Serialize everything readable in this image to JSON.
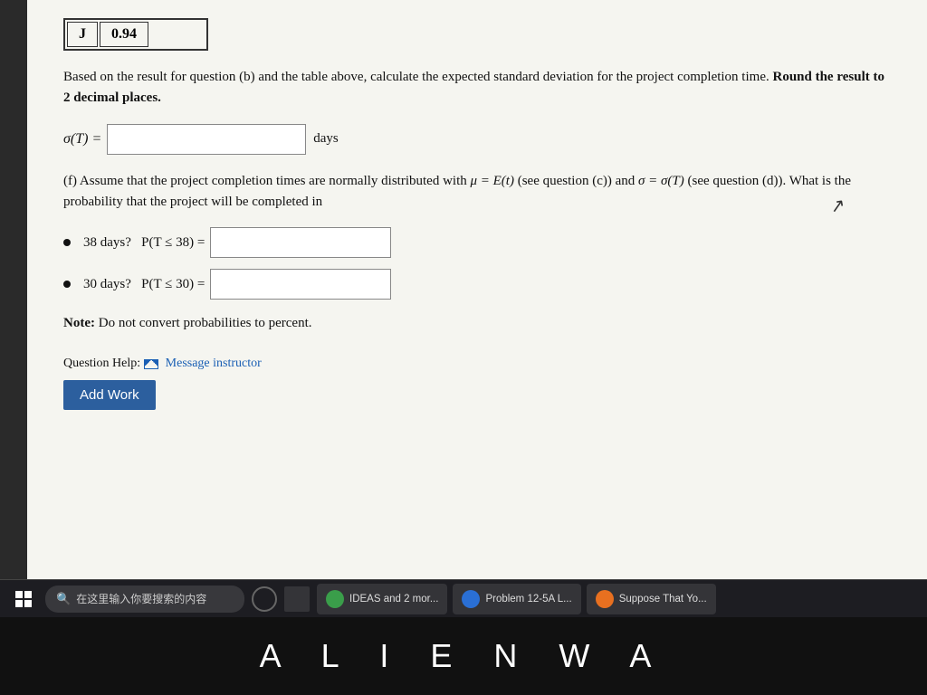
{
  "table": {
    "col1": "J",
    "col2": "0.94"
  },
  "question_c": {
    "text": "Based on the result for question (b) and the table above, calculate the expected standard deviation for the project completion time.",
    "bold_part": "Round the result to 2 decimal places.",
    "sigma_label": "σ(T) =",
    "days_label": "days",
    "input_placeholder": ""
  },
  "question_f": {
    "intro": "Assume that the project completion times are normally distributed with",
    "mu_part": "μ = E(t)",
    "see_c": "(see question (c)) and",
    "sigma_part": "σ = σ(T)",
    "see_d": "(see question (d)). What is the probability that the project will be completed in",
    "bullet1_label": "38 days?",
    "bullet1_prob": "P(T ≤ 38) =",
    "bullet2_label": "30 days?",
    "bullet2_prob": "P(T ≤ 30) ="
  },
  "note": {
    "label": "Note:",
    "text": "Do not convert probabilities to percent."
  },
  "help": {
    "label": "Question Help:",
    "message_label": "Message instructor"
  },
  "add_work_btn": "Add Work",
  "taskbar": {
    "search_placeholder": "在这里输入你要搜索的内容",
    "app1_label": "IDEAS and 2 mor...",
    "app2_label": "Problem 12-5A L...",
    "app3_label": "Suppose That Yo..."
  },
  "alienware": "A L I E N W A"
}
